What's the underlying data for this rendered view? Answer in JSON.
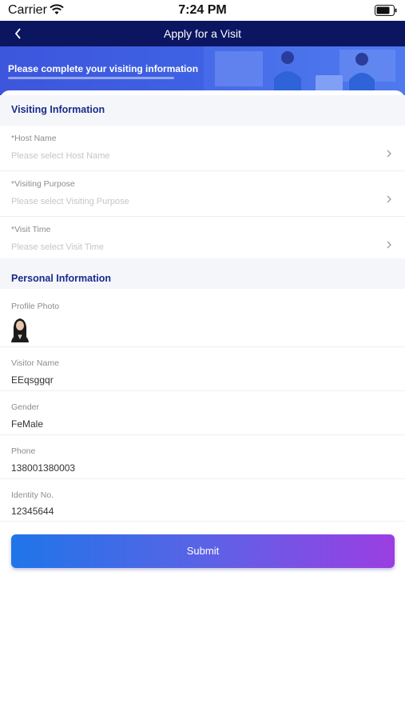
{
  "status": {
    "carrier": "Carrier",
    "time": "7:24 PM"
  },
  "nav": {
    "title": "Apply for a Visit"
  },
  "banner": {
    "text": "Please complete your visiting information"
  },
  "visiting": {
    "title": "Visiting Information",
    "host": {
      "label": "*Host Name",
      "placeholder": "Please select Host Name"
    },
    "purpose": {
      "label": "*Visiting Purpose",
      "placeholder": "Please select Visiting Purpose"
    },
    "time": {
      "label": "*Visit Time",
      "placeholder": "Please select Visit Time"
    }
  },
  "personal": {
    "title": "Personal Information",
    "photo": {
      "label": "Profile Photo"
    },
    "name": {
      "label": "Visitor Name",
      "value": "EEqsggqr"
    },
    "gender": {
      "label": "Gender",
      "value": "FeMale"
    },
    "phone": {
      "label": "Phone",
      "value": "138001380003"
    },
    "identity": {
      "label": "Identity No.",
      "value": "12345644"
    }
  },
  "submit": {
    "label": "Submit"
  },
  "colors": {
    "nav": "#0b1560",
    "banner": "#3e5ee2",
    "section_title": "#1a2a8c",
    "submit_start": "#1f75e8",
    "submit_end": "#9b3ee2"
  }
}
